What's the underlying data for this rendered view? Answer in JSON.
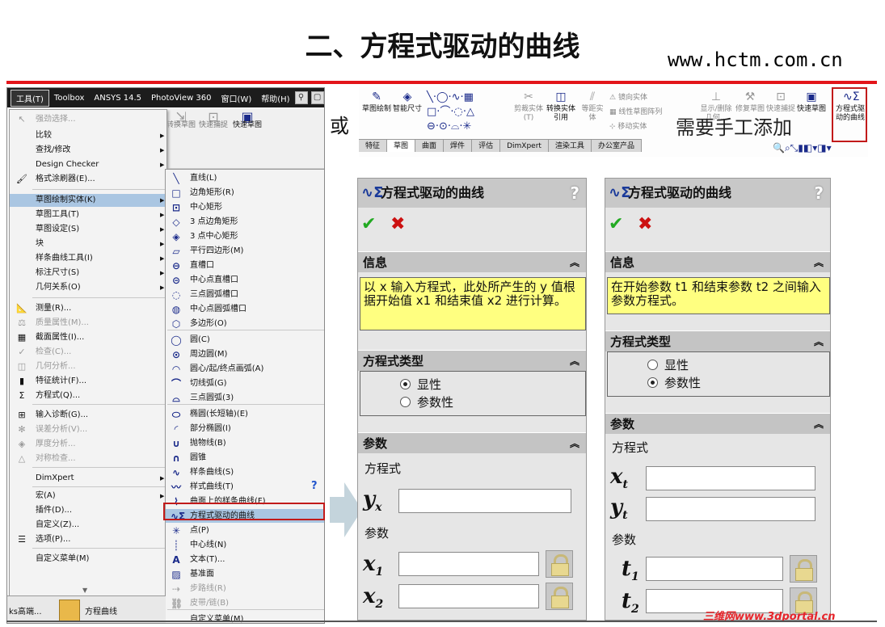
{
  "slide": {
    "title": "二、方程式驱动的曲线",
    "url": "www.hctm.com.cn",
    "or_text": "或",
    "need_text": "需要手工添加",
    "watermark": "三维网www.3dportal.cn"
  },
  "menubar": {
    "items": [
      "工具(T)",
      "Toolbox",
      "ANSYS 14.5",
      "PhotoView 360",
      "窗口(W)",
      "帮助(H)"
    ]
  },
  "toolstrip": {
    "b1": "转换草图",
    "b2": "快速捕捉",
    "b3": "快速草图"
  },
  "menu1": {
    "items": [
      {
        "label": "强劲选择...",
        "icon": "select-icon",
        "glyph": "↖",
        "dis": true
      },
      {
        "label": "比较",
        "arrow": "▶"
      },
      {
        "label": "查找/修改",
        "arrow": "▶"
      },
      {
        "label": "Design Checker",
        "arrow": "▶"
      },
      {
        "label": "格式涂刷器(E)...",
        "icon": "format-painter-icon",
        "glyph": "🖌"
      },
      {
        "label": "草图绘制实体(K)",
        "arrow": "▶",
        "hl": true
      },
      {
        "label": "草图工具(T)",
        "arrow": "▶"
      },
      {
        "label": "草图设定(S)",
        "arrow": "▶"
      },
      {
        "label": "块",
        "arrow": "▶"
      },
      {
        "label": "样条曲线工具(I)",
        "arrow": "▶"
      },
      {
        "label": "标注尺寸(S)",
        "arrow": "▶"
      },
      {
        "label": "几何关系(O)",
        "arrow": "▶"
      },
      {
        "label": "测量(R)...",
        "icon": "measure-icon",
        "glyph": "📐"
      },
      {
        "label": "质量属性(M)...",
        "icon": "mass-properties-icon",
        "glyph": "⚖",
        "dis": true
      },
      {
        "label": "截面属性(I)...",
        "icon": "section-properties-icon",
        "glyph": "▦"
      },
      {
        "label": "检查(C)...",
        "icon": "check-icon",
        "glyph": "✓",
        "dis": true
      },
      {
        "label": "几何分析...",
        "icon": "geometry-analysis-icon",
        "glyph": "◫",
        "dis": true
      },
      {
        "label": "特征统计(F)...",
        "icon": "feature-statistics-icon",
        "glyph": "▮"
      },
      {
        "label": "方程式(Q)...",
        "icon": "equations-icon",
        "glyph": "Σ"
      },
      {
        "label": "输入诊断(G)...",
        "icon": "import-diagnostics-icon",
        "glyph": "⊞"
      },
      {
        "label": "误差分析(V)...",
        "icon": "deviation-analysis-icon",
        "glyph": "✻",
        "dis": true
      },
      {
        "label": "厚度分析...",
        "icon": "thickness-analysis-icon",
        "glyph": "◈",
        "dis": true
      },
      {
        "label": "对称检查...",
        "icon": "symmetry-check-icon",
        "glyph": "△",
        "dis": true
      },
      {
        "label": "DimXpert",
        "arrow": "▶"
      },
      {
        "label": "宏(A)",
        "arrow": "▶"
      },
      {
        "label": "插件(D)..."
      },
      {
        "label": "自定义(Z)..."
      },
      {
        "label": "选项(P)...",
        "icon": "options-icon",
        "glyph": "☰"
      },
      {
        "label": "自定义菜单(M)"
      }
    ]
  },
  "menu2": {
    "items": [
      {
        "label": "直线(L)",
        "icon": "line-icon",
        "glyph": "╲"
      },
      {
        "label": "边角矩形(R)",
        "icon": "corner-rectangle-icon",
        "glyph": "□"
      },
      {
        "label": "中心矩形",
        "icon": "center-rectangle-icon",
        "glyph": "⊡"
      },
      {
        "label": "3 点边角矩形",
        "icon": "3pt-corner-rectangle-icon",
        "glyph": "◇"
      },
      {
        "label": "3 点中心矩形",
        "icon": "3pt-center-rectangle-icon",
        "glyph": "◈"
      },
      {
        "label": "平行四边形(M)",
        "icon": "parallelogram-icon",
        "glyph": "▱"
      },
      {
        "label": "直槽口",
        "icon": "straight-slot-icon",
        "glyph": "⊖"
      },
      {
        "label": "中心点直槽口",
        "icon": "centerpoint-slot-icon",
        "glyph": "⊝"
      },
      {
        "label": "三点圆弧槽口",
        "icon": "3pt-arc-slot-icon",
        "glyph": "◌"
      },
      {
        "label": "中心点圆弧槽口",
        "icon": "centerpoint-arc-slot-icon",
        "glyph": "◍"
      },
      {
        "label": "多边形(O)",
        "icon": "polygon-icon",
        "glyph": "⬡"
      },
      {
        "label": "圆(C)",
        "icon": "circle-icon",
        "glyph": "◯"
      },
      {
        "label": "周边圆(M)",
        "icon": "perimeter-circle-icon",
        "glyph": "⊙"
      },
      {
        "label": "圆心/起/终点画弧(A)",
        "icon": "centerpoint-arc-icon",
        "glyph": "◠"
      },
      {
        "label": "切线弧(G)",
        "icon": "tangent-arc-icon",
        "glyph": "⌒"
      },
      {
        "label": "三点圆弧(3)",
        "icon": "3pt-arc-icon",
        "glyph": "⌓"
      },
      {
        "label": "椭圆(长短轴)(E)",
        "icon": "ellipse-icon",
        "glyph": "⬭"
      },
      {
        "label": "部分椭圆(I)",
        "icon": "partial-ellipse-icon",
        "glyph": "◜"
      },
      {
        "label": "抛物线(B)",
        "icon": "parabola-icon",
        "glyph": "∪"
      },
      {
        "label": "圆锥",
        "icon": "conic-icon",
        "glyph": "∩"
      },
      {
        "label": "样条曲线(S)",
        "icon": "spline-icon",
        "glyph": "∿"
      },
      {
        "label": "样式曲线(T)",
        "icon": "style-spline-icon",
        "glyph": "〰"
      },
      {
        "label": "曲面上的样条曲线(F)",
        "icon": "spline-on-surface-icon",
        "glyph": "⌇"
      },
      {
        "label": "方程式驱动的曲线",
        "icon": "equation-driven-curve-icon",
        "glyph": "∿Σ",
        "hl": true
      },
      {
        "label": "点(P)",
        "icon": "point-icon",
        "glyph": "✳"
      },
      {
        "label": "中心线(N)",
        "icon": "centerline-icon",
        "glyph": "┊"
      },
      {
        "label": "文本(T)...",
        "icon": "text-icon",
        "glyph": "A"
      },
      {
        "label": "基准面",
        "icon": "plane-icon",
        "glyph": "▨"
      },
      {
        "label": "步路线(R)",
        "icon": "route-line-icon",
        "glyph": "⇢",
        "dis": true
      },
      {
        "label": "皮带/链(B)",
        "icon": "belt-chain-icon",
        "glyph": "⛓",
        "dis": true
      },
      {
        "label": "自定义菜单(M)"
      }
    ]
  },
  "taskbar": {
    "item1": "ks高端...",
    "item2": "方程曲线"
  },
  "ribbon": {
    "btn_sketch": "草图绘制",
    "btn_dim": "智能尺寸",
    "btn_trim": "剪裁实体(T)",
    "btn_convert": "转换实体引用",
    "btn_offset": "等距实体",
    "btn_mirror": "镜向实体",
    "btn_pattern": "线性草图阵列",
    "btn_move": "移动实体",
    "btn_showhide": "显示/删除几何...",
    "btn_repair": "修复草图",
    "btn_snap": "快速捕捉",
    "btn_quick": "快速草图",
    "btn_eqcurve": "方程式驱动的曲线",
    "tabs": [
      "特征",
      "草图",
      "曲面",
      "焊件",
      "评估",
      "DimXpert",
      "渲染工具",
      "办公室产品"
    ]
  },
  "pm_left": {
    "title": "方程式驱动的曲线",
    "q": "?",
    "info_header": "信息",
    "info_text": "以 x 输入方程式，此处所产生的 y 值根据开始值 x1 和结束值 x2 进行计算。",
    "type_header": "方程式类型",
    "opt_explicit": "显性",
    "opt_parametric": "参数性",
    "param_header": "参数",
    "eq_label": "方程式",
    "param_label": "参数"
  },
  "pm_right": {
    "title": "方程式驱动的曲线",
    "q": "?",
    "info_header": "信息",
    "info_text": "在开始参数 t1 和结束参数 t2 之间输入参数方程式。",
    "type_header": "方程式类型",
    "opt_explicit": "显性",
    "opt_parametric": "参数性",
    "param_header": "参数",
    "eq_label": "方程式",
    "param_label": "参数"
  },
  "colors": {
    "accent_red": "#e3151a",
    "info_yellow": "#ffff80",
    "highlight": "#aac6e2"
  }
}
